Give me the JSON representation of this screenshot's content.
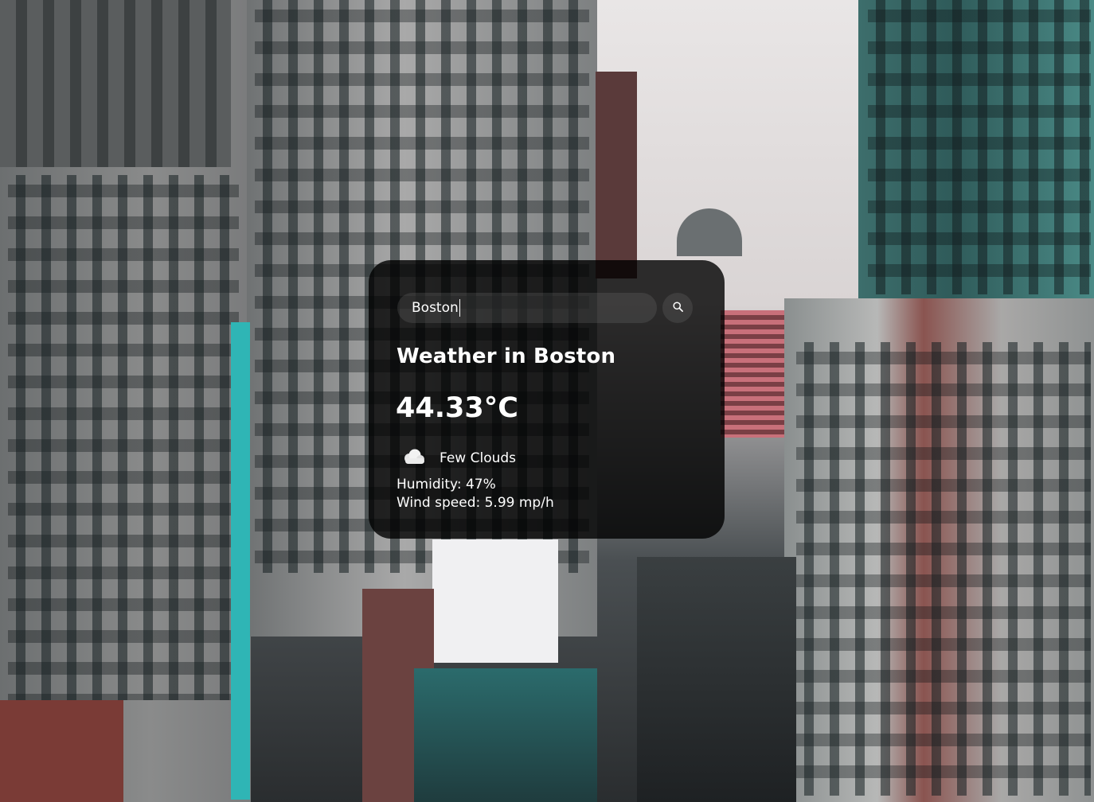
{
  "search": {
    "value": "Boston",
    "placeholder": "Search"
  },
  "weather": {
    "title": "Weather in Boston",
    "temperature": "44.33°C",
    "condition": "Few Clouds",
    "condition_icon": "cloud-icon",
    "humidity": "Humidity: 47%",
    "wind": "Wind speed: 5.99 mp/h"
  },
  "icons": {
    "search": "search-icon",
    "condition": "cloud-icon"
  },
  "colors": {
    "card_background": "#000000",
    "text": "#ffffff",
    "input_background": "#7e7e7e"
  }
}
